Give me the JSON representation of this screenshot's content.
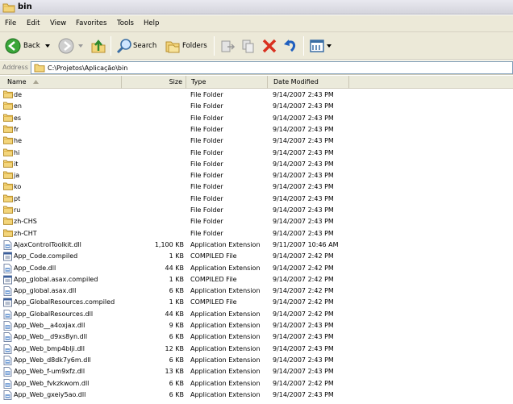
{
  "window": {
    "title": "bin"
  },
  "menu": [
    "File",
    "Edit",
    "View",
    "Favorites",
    "Tools",
    "Help"
  ],
  "toolbar": {
    "back_label": "Back",
    "search_label": "Search",
    "folders_label": "Folders"
  },
  "address": {
    "label": "Address",
    "path": "C:\\Projetos\\Aplicação\\bin"
  },
  "columns": {
    "name": "Name",
    "size": "Size",
    "type": "Type",
    "date": "Date Modified"
  },
  "files": [
    {
      "name": "de",
      "size": "",
      "type": "File Folder",
      "date": "9/14/2007 2:43 PM",
      "icon": "folder-icon"
    },
    {
      "name": "en",
      "size": "",
      "type": "File Folder",
      "date": "9/14/2007 2:43 PM",
      "icon": "folder-icon"
    },
    {
      "name": "es",
      "size": "",
      "type": "File Folder",
      "date": "9/14/2007 2:43 PM",
      "icon": "folder-icon"
    },
    {
      "name": "fr",
      "size": "",
      "type": "File Folder",
      "date": "9/14/2007 2:43 PM",
      "icon": "folder-icon"
    },
    {
      "name": "he",
      "size": "",
      "type": "File Folder",
      "date": "9/14/2007 2:43 PM",
      "icon": "folder-icon"
    },
    {
      "name": "hi",
      "size": "",
      "type": "File Folder",
      "date": "9/14/2007 2:43 PM",
      "icon": "folder-icon"
    },
    {
      "name": "it",
      "size": "",
      "type": "File Folder",
      "date": "9/14/2007 2:43 PM",
      "icon": "folder-icon"
    },
    {
      "name": "ja",
      "size": "",
      "type": "File Folder",
      "date": "9/14/2007 2:43 PM",
      "icon": "folder-icon"
    },
    {
      "name": "ko",
      "size": "",
      "type": "File Folder",
      "date": "9/14/2007 2:43 PM",
      "icon": "folder-icon"
    },
    {
      "name": "pt",
      "size": "",
      "type": "File Folder",
      "date": "9/14/2007 2:43 PM",
      "icon": "folder-icon"
    },
    {
      "name": "ru",
      "size": "",
      "type": "File Folder",
      "date": "9/14/2007 2:43 PM",
      "icon": "folder-icon"
    },
    {
      "name": "zh-CHS",
      "size": "",
      "type": "File Folder",
      "date": "9/14/2007 2:43 PM",
      "icon": "folder-icon"
    },
    {
      "name": "zh-CHT",
      "size": "",
      "type": "File Folder",
      "date": "9/14/2007 2:43 PM",
      "icon": "folder-icon"
    },
    {
      "name": "AjaxControlToolkit.dll",
      "size": "1,100 KB",
      "type": "Application Extension",
      "date": "9/11/2007 10:46 AM",
      "icon": "dll-file-icon"
    },
    {
      "name": "App_Code.compiled",
      "size": "1 KB",
      "type": "COMPILED File",
      "date": "9/14/2007 2:42 PM",
      "icon": "compiled-file-icon"
    },
    {
      "name": "App_Code.dll",
      "size": "44 KB",
      "type": "Application Extension",
      "date": "9/14/2007 2:42 PM",
      "icon": "dll-file-icon"
    },
    {
      "name": "App_global.asax.compiled",
      "size": "1 KB",
      "type": "COMPILED File",
      "date": "9/14/2007 2:42 PM",
      "icon": "compiled-file-icon"
    },
    {
      "name": "App_global.asax.dll",
      "size": "6 KB",
      "type": "Application Extension",
      "date": "9/14/2007 2:42 PM",
      "icon": "dll-file-icon"
    },
    {
      "name": "App_GlobalResources.compiled",
      "size": "1 KB",
      "type": "COMPILED File",
      "date": "9/14/2007 2:42 PM",
      "icon": "compiled-file-icon"
    },
    {
      "name": "App_GlobalResources.dll",
      "size": "44 KB",
      "type": "Application Extension",
      "date": "9/14/2007 2:42 PM",
      "icon": "dll-file-icon"
    },
    {
      "name": "App_Web__a4oxjax.dll",
      "size": "9 KB",
      "type": "Application Extension",
      "date": "9/14/2007 2:43 PM",
      "icon": "dll-file-icon"
    },
    {
      "name": "App_Web__d9xs8yn.dll",
      "size": "6 KB",
      "type": "Application Extension",
      "date": "9/14/2007 2:43 PM",
      "icon": "dll-file-icon"
    },
    {
      "name": "App_Web_bmp4blji.dll",
      "size": "12 KB",
      "type": "Application Extension",
      "date": "9/14/2007 2:43 PM",
      "icon": "dll-file-icon"
    },
    {
      "name": "App_Web_d8dk7y6m.dll",
      "size": "6 KB",
      "type": "Application Extension",
      "date": "9/14/2007 2:43 PM",
      "icon": "dll-file-icon"
    },
    {
      "name": "App_Web_f-um9xfz.dll",
      "size": "13 KB",
      "type": "Application Extension",
      "date": "9/14/2007 2:43 PM",
      "icon": "dll-file-icon"
    },
    {
      "name": "App_Web_fvkzkwom.dll",
      "size": "6 KB",
      "type": "Application Extension",
      "date": "9/14/2007 2:42 PM",
      "icon": "dll-file-icon"
    },
    {
      "name": "App_Web_gxeiy5ao.dll",
      "size": "6 KB",
      "type": "Application Extension",
      "date": "9/14/2007 2:43 PM",
      "icon": "dll-file-icon"
    }
  ]
}
